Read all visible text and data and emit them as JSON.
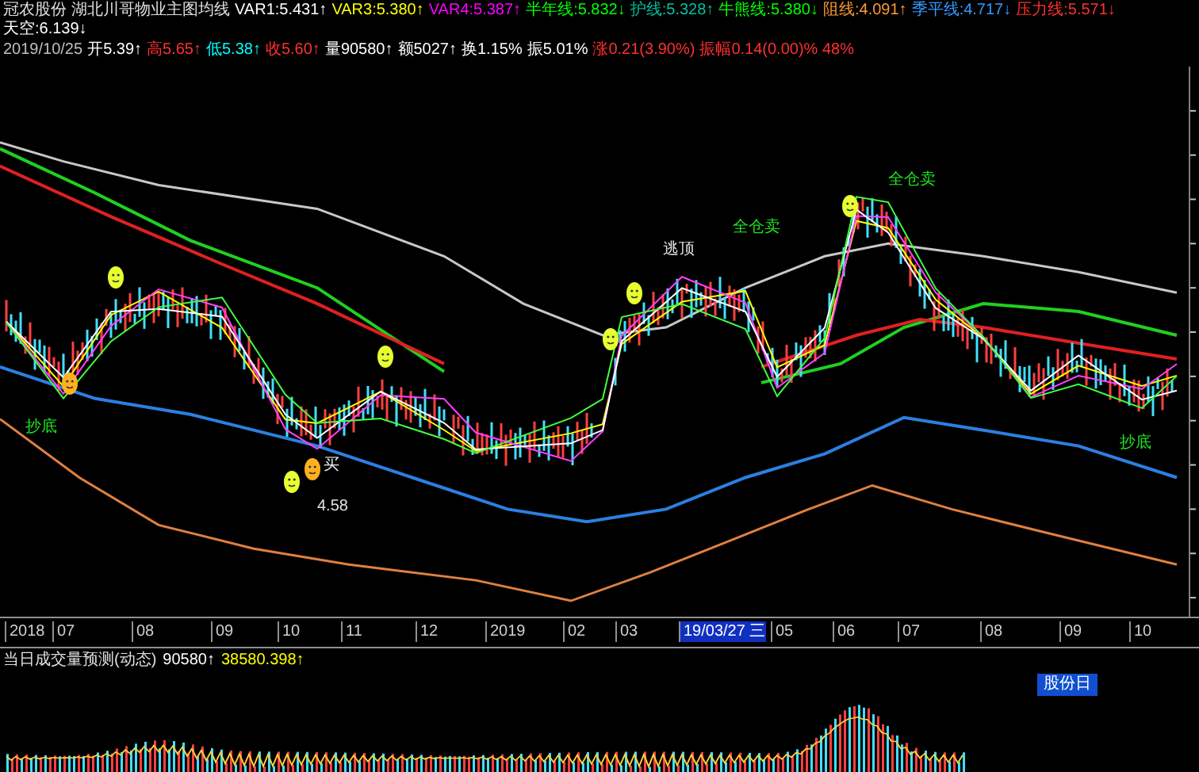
{
  "legend_rows": [
    [
      {
        "text": "冠农股份",
        "color": "#e0e0e0"
      },
      {
        "text": "湖北川哥物业主图均线",
        "color": "#e0e0e0"
      },
      {
        "text": "VAR1:5.431↑",
        "color": "#ffffff"
      },
      {
        "text": "VAR3:5.380↑",
        "color": "#ffff00"
      },
      {
        "text": "VAR4:5.387↑",
        "color": "#ff00ff"
      },
      {
        "text": "半年线:5.832↓",
        "color": "#00ff00"
      },
      {
        "text": "护线:5.328↑",
        "color": "#00c0a0"
      },
      {
        "text": "牛熊线:5.380↓",
        "color": "#00ff00"
      },
      {
        "text": "阻线:4.091↑",
        "color": "#ff9933"
      },
      {
        "text": "季平线:4.717↓",
        "color": "#3399ff"
      },
      {
        "text": "压力线:5.571↓",
        "color": "#ff3030"
      },
      {
        "text": "天空:6.139↓",
        "color": "#ffffff"
      }
    ],
    [
      {
        "text": "2019/10/25",
        "color": "#c0c0c0"
      },
      {
        "text": "开5.39↑",
        "color": "#ffffff"
      },
      {
        "text": "高5.65↑",
        "color": "#ff3030"
      },
      {
        "text": "低5.38↑",
        "color": "#00ffff"
      },
      {
        "text": "收5.60↑",
        "color": "#ff3030"
      },
      {
        "text": "量90580↑",
        "color": "#ffffff"
      },
      {
        "text": "额5027↑",
        "color": "#ffffff"
      },
      {
        "text": "换1.15%",
        "color": "#ffffff"
      },
      {
        "text": "振5.01%",
        "color": "#ffffff"
      },
      {
        "text": "涨0.21(3.90%)",
        "color": "#ff3030"
      },
      {
        "text": "振幅0.14(0.00)% 48%",
        "color": "#ff3030"
      }
    ]
  ],
  "signals": [
    {
      "text": "抄底"
    },
    {
      "text": "买"
    },
    {
      "text": "4.58"
    },
    {
      "text": "逃顶"
    },
    {
      "text": "全仓卖"
    },
    {
      "text": "全仓卖"
    },
    {
      "text": "抄底"
    }
  ],
  "time_axis": [
    {
      "label": "2018",
      "selected": false
    },
    {
      "label": "07",
      "selected": false
    },
    {
      "label": "08",
      "selected": false
    },
    {
      "label": "09",
      "selected": false
    },
    {
      "label": "10",
      "selected": false
    },
    {
      "label": "11",
      "selected": false
    },
    {
      "label": "12",
      "selected": false
    },
    {
      "label": "2019",
      "selected": false
    },
    {
      "label": "02",
      "selected": false
    },
    {
      "label": "03",
      "selected": false
    },
    {
      "label": "19/03/27 三",
      "selected": true
    },
    {
      "label": "05",
      "selected": false
    },
    {
      "label": "06",
      "selected": false
    },
    {
      "label": "07",
      "selected": false
    },
    {
      "label": "08",
      "selected": false
    },
    {
      "label": "09",
      "selected": false
    },
    {
      "label": "10",
      "selected": false
    }
  ],
  "volume_panel": {
    "title": "当日成交量预测(动态)",
    "values": [
      {
        "text": "90580↑",
        "color": "#ffffff"
      },
      {
        "text": "38580.398↑",
        "color": "#ffff00"
      }
    ],
    "badge": "股份日"
  }
}
